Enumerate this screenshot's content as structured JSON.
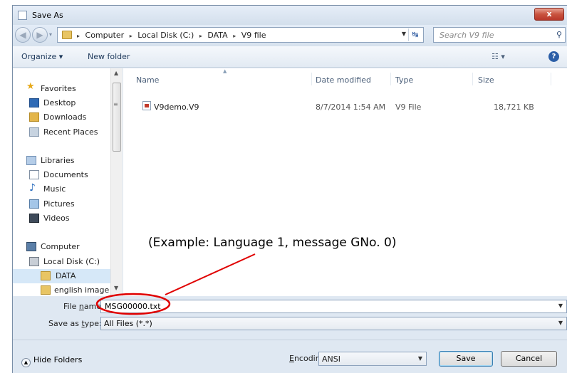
{
  "window": {
    "title": "Save As",
    "close_label": "x"
  },
  "address": {
    "crumbs": [
      "Computer",
      "Local Disk (C:)",
      "DATA",
      "V9 file"
    ],
    "separator": "▸",
    "search_placeholder": "Search V9 file"
  },
  "toolbar": {
    "organize": "Organize ▾",
    "new_folder": "New folder",
    "help": "?"
  },
  "sidebar": {
    "items": [
      {
        "label": "Favorites",
        "icon": "star-icon"
      },
      {
        "label": "Desktop",
        "icon": "desktop-icon"
      },
      {
        "label": "Downloads",
        "icon": "downloads-icon"
      },
      {
        "label": "Recent Places",
        "icon": "recent-places-icon"
      },
      {
        "label": "Libraries",
        "icon": "libraries-icon"
      },
      {
        "label": "Documents",
        "icon": "documents-icon"
      },
      {
        "label": "Music",
        "icon": "music-icon"
      },
      {
        "label": "Pictures",
        "icon": "pictures-icon"
      },
      {
        "label": "Videos",
        "icon": "videos-icon"
      },
      {
        "label": "Computer",
        "icon": "computer-icon"
      },
      {
        "label": "Local Disk (C:)",
        "icon": "disk-icon"
      },
      {
        "label": "DATA",
        "icon": "folder-icon",
        "selected": true
      },
      {
        "label": "english image",
        "icon": "folder-icon"
      }
    ]
  },
  "filelist": {
    "columns": [
      "Name",
      "Date modified",
      "Type",
      "Size"
    ],
    "rows": [
      {
        "name": "V9demo.V9",
        "date": "8/7/2014 1:54 AM",
        "type": "V9 File",
        "size": "18,721 KB"
      }
    ]
  },
  "form": {
    "filename_label_pre": "File ",
    "filename_label_u": "n",
    "filename_label_post": "ame:",
    "filename_value": "MSG00000.txt",
    "type_label_pre": "Save as ",
    "type_label_u": "t",
    "type_label_post": "ype:",
    "type_value": "All Files  (*.*)",
    "encoding_label_u": "E",
    "encoding_label_post": "ncoding:",
    "encoding_value": "ANSI"
  },
  "buttons": {
    "hide_folders": "Hide Folders",
    "save": "Save",
    "cancel": "Cancel"
  },
  "annotation": {
    "text": "(Example: Language 1, message GNo. 0)",
    "color": "#e00000"
  }
}
